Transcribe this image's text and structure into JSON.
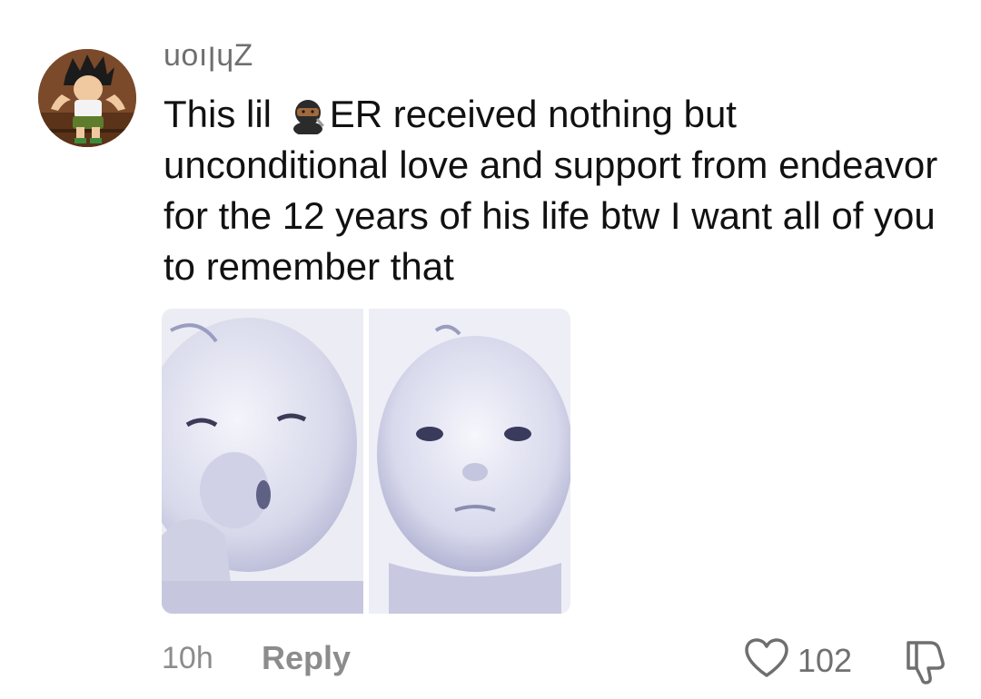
{
  "comment": {
    "username": "uoıןɥZ",
    "text_before_emoji": "This lil ",
    "emoji_icon": "ninja-emoji",
    "text_after_emoji": "ER received nothing but unconditional love and support from endeavor for the 12 years of his life btw I want all of you to remember that",
    "timestamp": "10h",
    "reply_label": "Reply",
    "like_count": "102",
    "like_icon": "heart-outline-icon",
    "dislike_icon": "thumbs-down-icon"
  },
  "colors": {
    "secondary_text": "#8c8c8c",
    "primary_text": "#111111",
    "background": "#ffffff"
  }
}
